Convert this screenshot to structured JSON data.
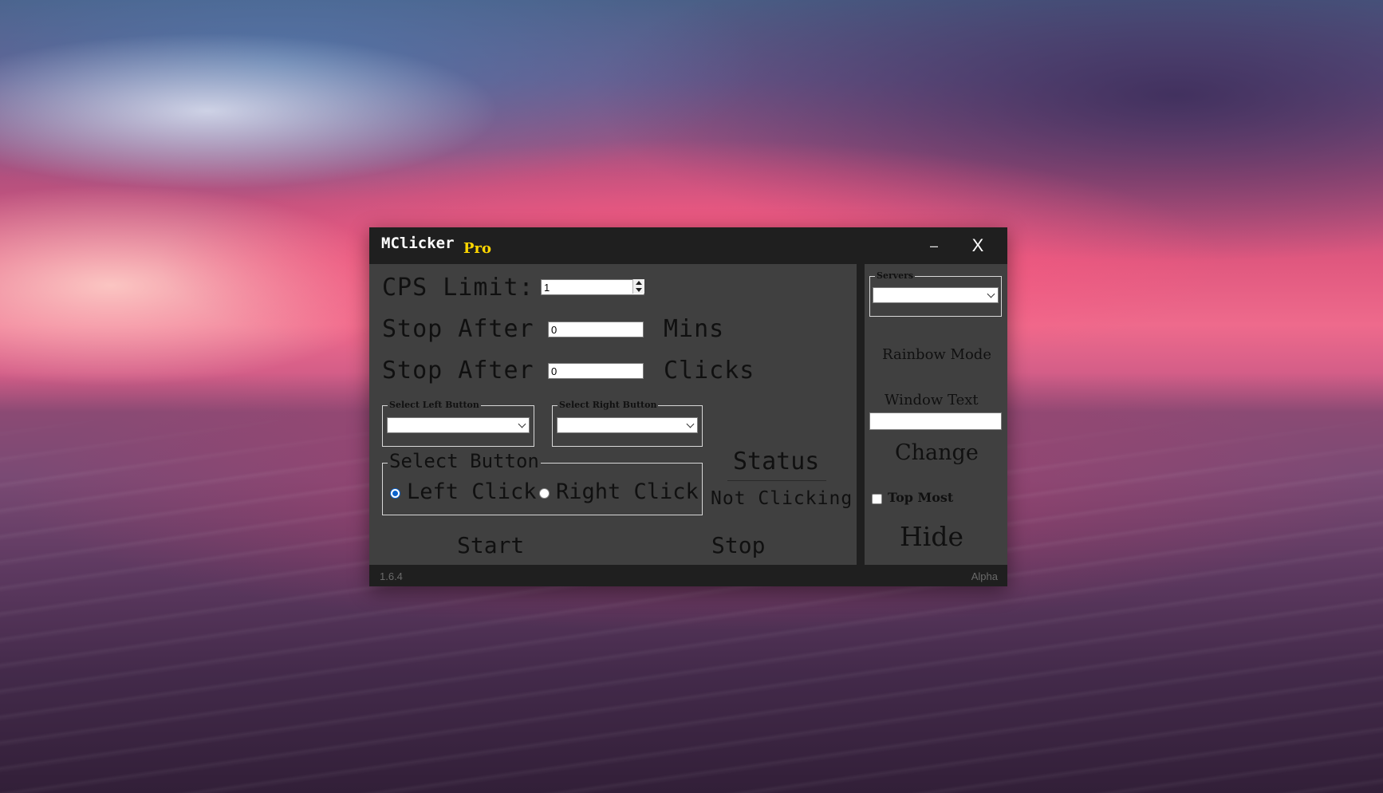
{
  "window": {
    "title": "MClicker",
    "edition": "Pro",
    "minimize_glyph": "–",
    "close_glyph": "X",
    "version": "1.6.4",
    "stage": "Alpha"
  },
  "main": {
    "cps_label": "CPS Limit:",
    "cps_value": "1",
    "stop_after_label": "Stop After",
    "mins_value": "0",
    "mins_unit": "Mins",
    "clicks_value": "0",
    "clicks_unit": "Clicks",
    "left_button_group": "Select Left Button",
    "left_button_selected": "",
    "right_button_group": "Select Right Button",
    "right_button_selected": "",
    "select_button_group": "Select Button",
    "left_click_label": "Left Click",
    "right_click_label": "Right Click",
    "selected_click": "Left Click",
    "status_title": "Status",
    "status_value": "Not Clicking",
    "start_label": "Start",
    "stop_label": "Stop"
  },
  "side": {
    "servers_group": "Servers",
    "servers_selected": "",
    "rainbow_mode_label": "Rainbow Mode",
    "window_text_label": "Window Text",
    "window_text_value": "",
    "change_label": "Change",
    "top_most_label": "Top Most",
    "top_most_checked": false,
    "hide_label": "Hide"
  },
  "colors": {
    "window_bg": "#1f1f1f",
    "panel_bg": "#404040",
    "edition_accent": "#ffd700",
    "radio_accent": "#0b63ce"
  }
}
